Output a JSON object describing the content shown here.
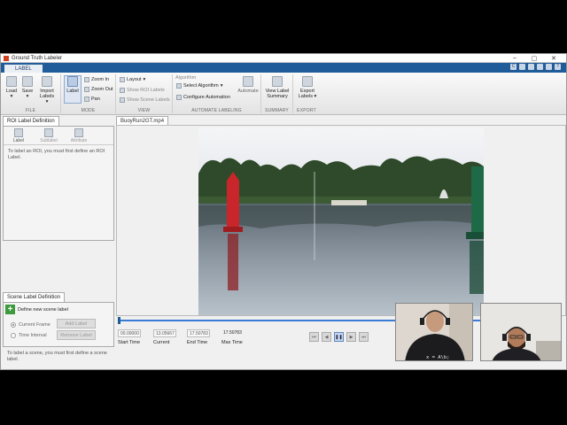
{
  "window": {
    "title": "Ground Truth Labeler",
    "minimize": "–",
    "maximize": "▢",
    "close": "✕"
  },
  "ribbon_tab": "LABEL",
  "quick_access": [
    "C",
    "",
    "",
    "",
    "",
    "?"
  ],
  "ribbon": {
    "file": {
      "name": "FILE",
      "load": "Load",
      "save": "Save",
      "import_labels": [
        "Import",
        "Labels"
      ]
    },
    "mode": {
      "name": "MODE",
      "label": "Label",
      "zoom_in": "Zoom In",
      "zoom_out": "Zoom Out",
      "pan": "Pan"
    },
    "view": {
      "name": "VIEW",
      "layout": "Layout",
      "show_roi": "Show ROI Labels",
      "show_scene": "Show Scene Labels"
    },
    "automate": {
      "name": "AUTOMATE LABELING",
      "algorithm_caption": "Algorithm",
      "select_algorithm": "Select Algorithm",
      "configure": "Configure Automation",
      "automate": "Automate"
    },
    "summary": {
      "name": "SUMMARY",
      "view_label_summary": [
        "View Label",
        "Summary"
      ]
    },
    "export": {
      "name": "EXPORT",
      "export_labels": [
        "Export",
        "Labels"
      ]
    }
  },
  "roi_panel": {
    "tab": "ROI Label Definition",
    "tools": [
      "Label",
      "Sublabel",
      "Attribute"
    ],
    "hint": "To label an ROI, you must first define an ROI Label."
  },
  "scene_panel": {
    "tab": "Scene Label Definition",
    "define_new": "Define new scene label",
    "current_frame": "Current Frame",
    "time_interval": "Time Interval",
    "add_label": "Add Label",
    "remove_label": "Remove Label",
    "hint": "To label a scene, you must first define a scene label."
  },
  "video_tab": "BuoyRun2GT.mp4",
  "playback": {
    "start_time": {
      "value": "00.00000",
      "label": "Start Time"
    },
    "current": {
      "value": "13.05667",
      "label": "Current"
    },
    "end_time": {
      "value": "17.50783",
      "label": "End Time"
    },
    "max_time": {
      "value": "17.50783",
      "label": "Max Time"
    },
    "progress": 0.0
  },
  "webcam_caption": "x = A\\b;",
  "colors": {
    "accent": "#1f5c99",
    "add_green": "#3d9a3d",
    "buoy_red": "#c8262a",
    "buoy_green": "#1e6a46"
  }
}
